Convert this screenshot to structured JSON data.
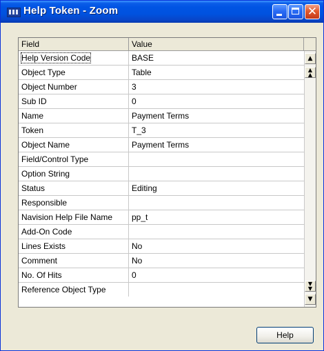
{
  "window": {
    "title": "Help Token - Zoom",
    "icon": "table-window-icon",
    "controls": [
      "minimize-icon",
      "maximize-icon",
      "close-icon"
    ]
  },
  "grid": {
    "columns": [
      "Field",
      "Value"
    ],
    "rows": [
      {
        "field": "Help Version Code",
        "value": "BASE"
      },
      {
        "field": "Object Type",
        "value": "Table"
      },
      {
        "field": "Object Number",
        "value": "3"
      },
      {
        "field": "Sub ID",
        "value": "0"
      },
      {
        "field": "Name",
        "value": "Payment Terms"
      },
      {
        "field": "Token",
        "value": "T_3"
      },
      {
        "field": "Object Name",
        "value": "Payment Terms"
      },
      {
        "field": "Field/Control Type",
        "value": ""
      },
      {
        "field": "Option String",
        "value": ""
      },
      {
        "field": "Status",
        "value": "Editing"
      },
      {
        "field": "Responsible",
        "value": ""
      },
      {
        "field": "Navision Help File Name",
        "value": "pp_t"
      },
      {
        "field": "Add-On Code",
        "value": ""
      },
      {
        "field": "Lines Exists",
        "value": "No"
      },
      {
        "field": "Comment",
        "value": "No"
      },
      {
        "field": "No. Of Hits",
        "value": "0"
      },
      {
        "field": "Reference Object Type",
        "value": ""
      }
    ],
    "scrollbar_icons": [
      "arrow-up-icon",
      "page-up-icon",
      "page-down-icon",
      "arrow-down-icon"
    ]
  },
  "footer": {
    "help_label": "Help"
  }
}
